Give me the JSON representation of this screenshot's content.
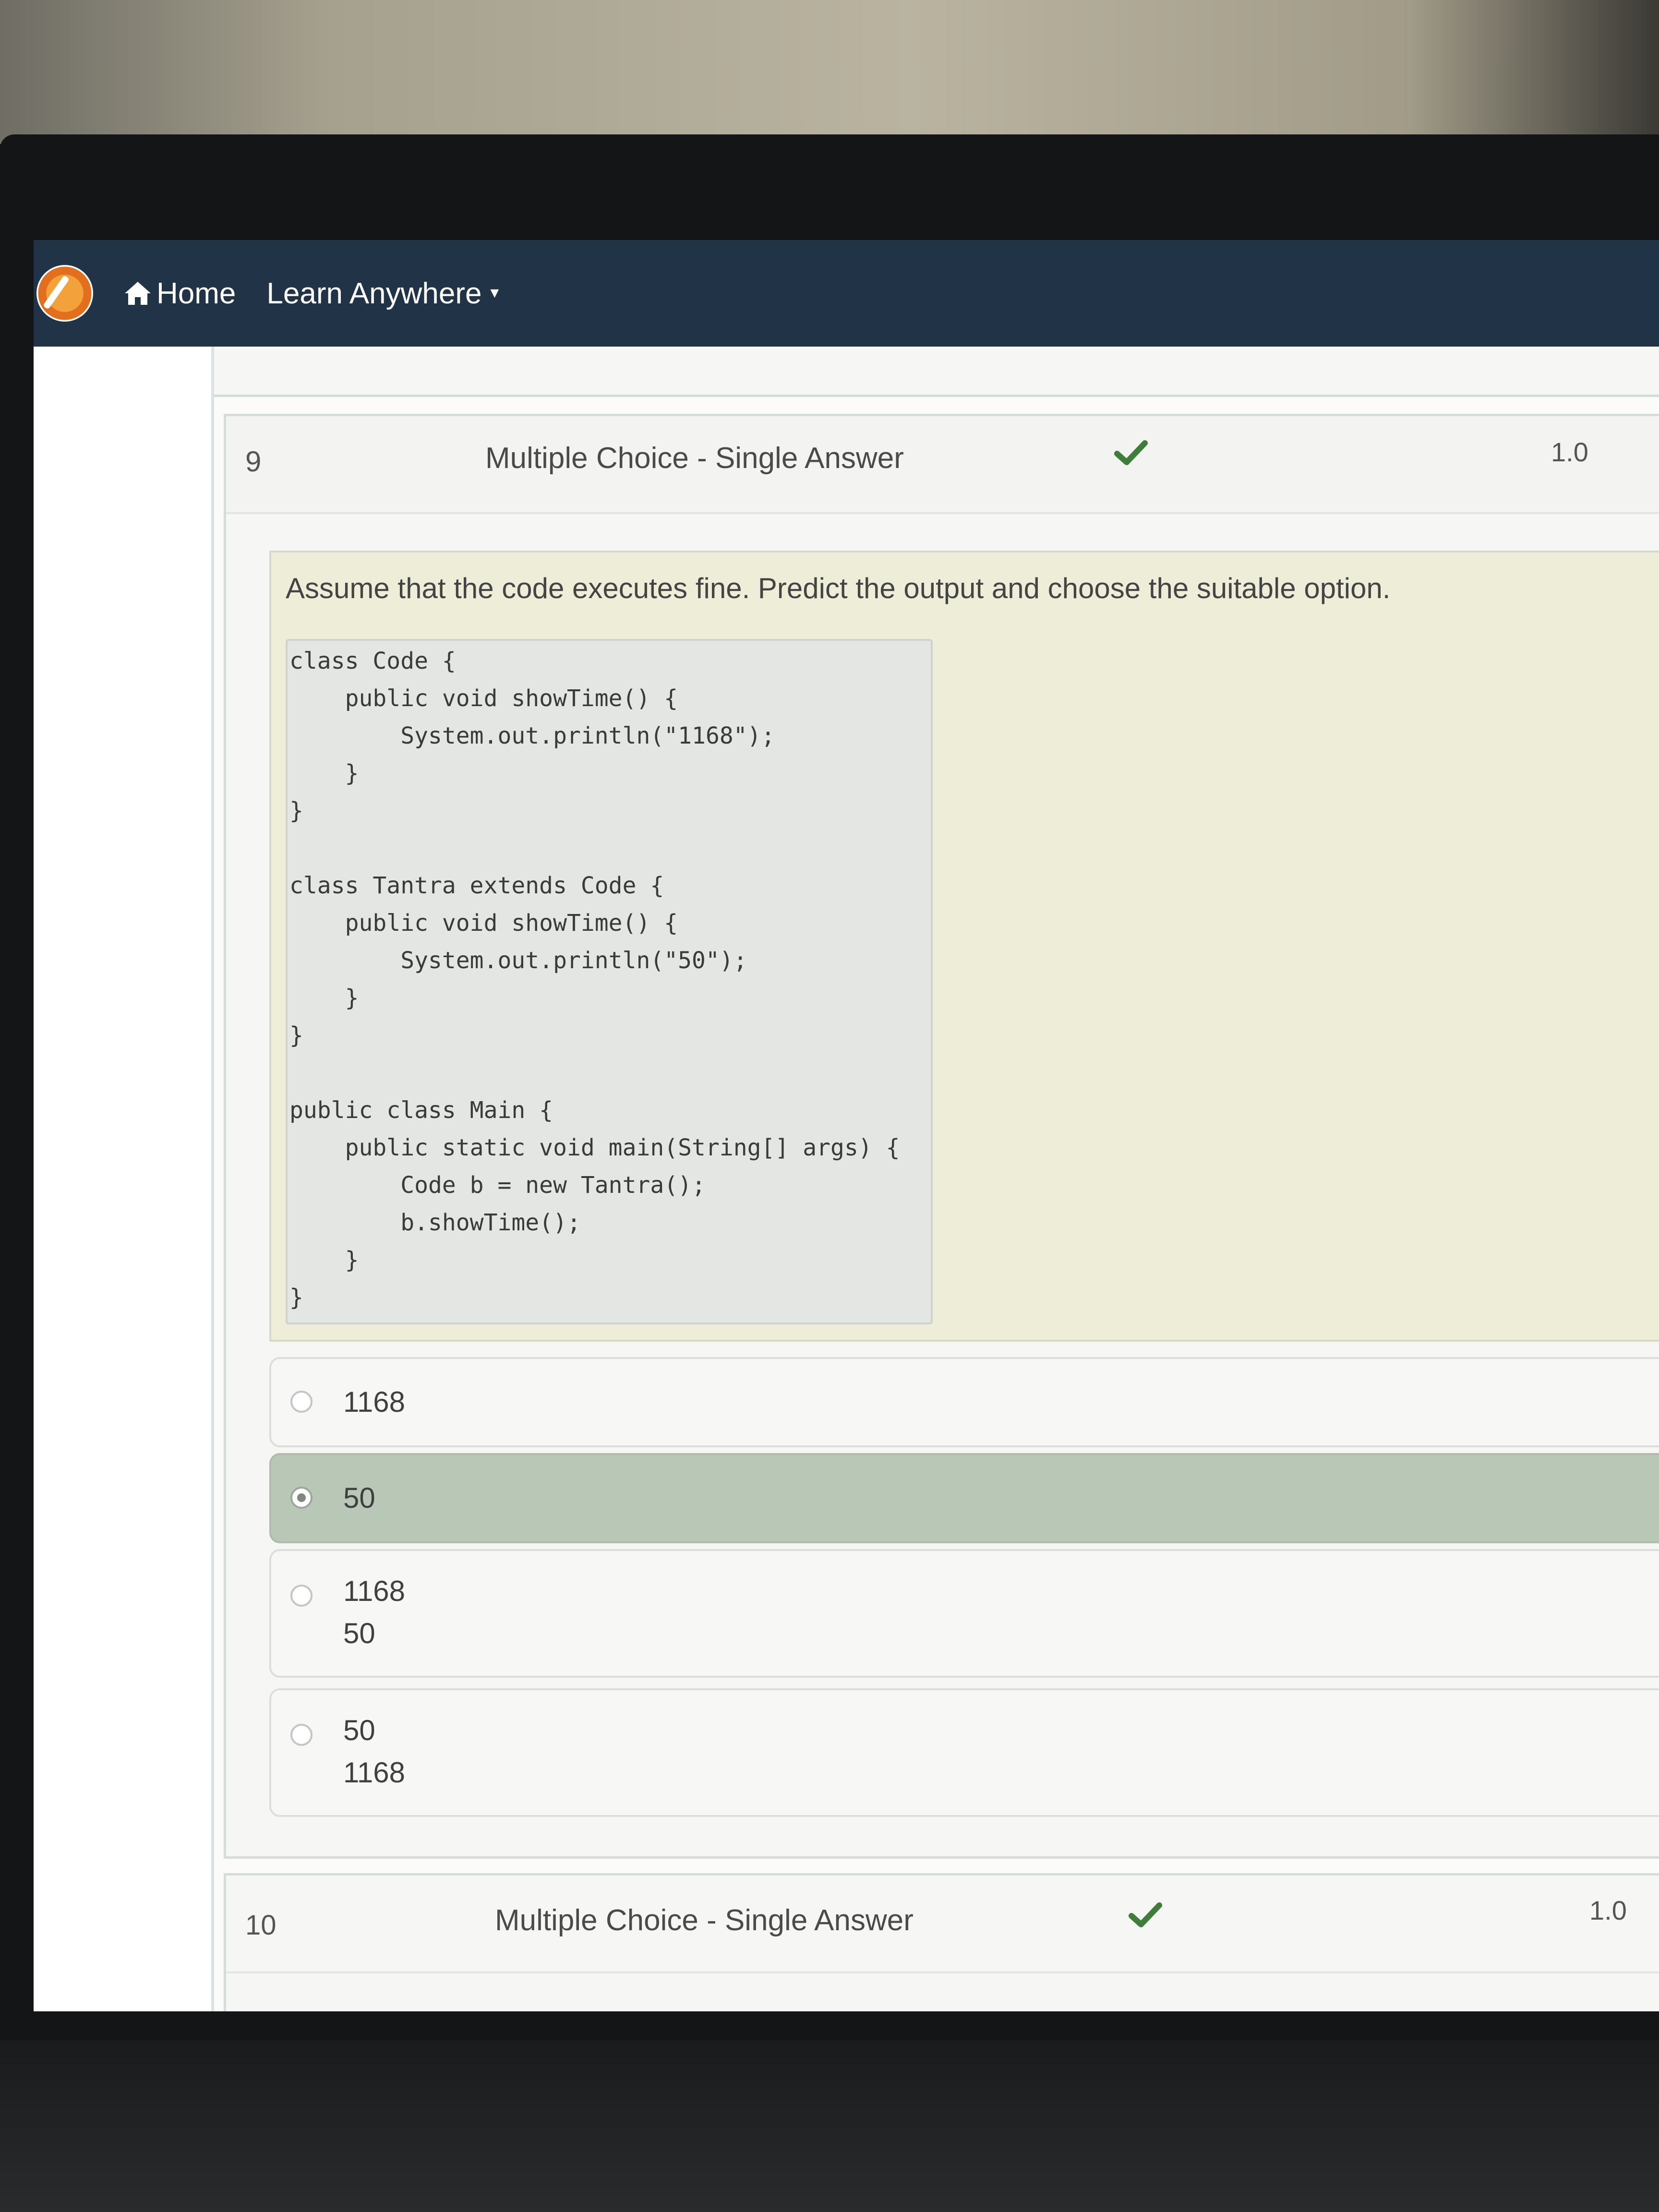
{
  "navbar": {
    "home_label": "Home",
    "learn_label": "Learn Anywhere",
    "home_icon": "home-icon",
    "logo_icon": "lpu-logo-icon",
    "caret_icon": "caret-down-icon"
  },
  "question9": {
    "number": "9",
    "type": "Multiple Choice - Single Answer",
    "status_icon": "checkmark-icon",
    "score": "1.0",
    "prompt": "Assume that the code executes fine. Predict the output and choose the suitable option.",
    "code": [
      "class Code {",
      "    public void showTime() {",
      "        System.out.println(\"1168\");",
      "    }",
      "}",
      "",
      "class Tantra extends Code {",
      "    public void showTime() {",
      "        System.out.println(\"50\");",
      "    }",
      "}",
      "",
      "public class Main {",
      "    public static void main(String[] args) {",
      "        Code b = new Tantra();",
      "        b.showTime();",
      "    }",
      "}"
    ],
    "options": [
      {
        "lines": [
          "1168"
        ],
        "selected": false
      },
      {
        "lines": [
          "50"
        ],
        "selected": true
      },
      {
        "lines": [
          "1168",
          "50"
        ],
        "selected": false
      },
      {
        "lines": [
          "50",
          "1168"
        ],
        "selected": false
      }
    ]
  },
  "question10": {
    "number": "10",
    "type": "Multiple Choice - Single Answer",
    "status_icon": "checkmark-icon",
    "score": "1.0"
  },
  "colors": {
    "navbar": "#213447",
    "selected_option": "#b9c8b6",
    "check": "#3f7d3b"
  }
}
